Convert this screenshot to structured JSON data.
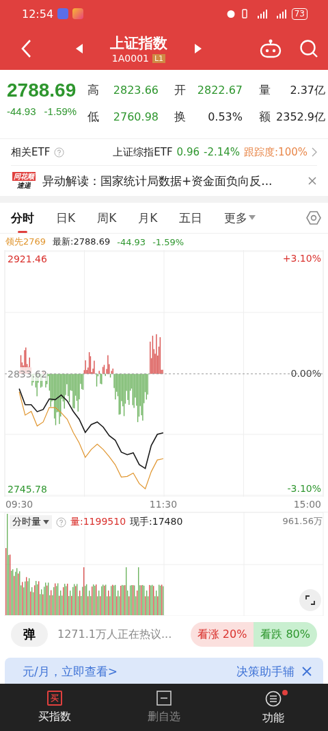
{
  "status_bar": {
    "time": "12:54",
    "battery": "73"
  },
  "header": {
    "title": "上证指数",
    "code": "1A0001",
    "level_badge": "L1"
  },
  "quote": {
    "price": "2788.69",
    "change": "-44.93",
    "change_pct": "-1.59%",
    "fields": [
      {
        "label": "高",
        "value": "2823.66",
        "color": "#2e962e"
      },
      {
        "label": "开",
        "value": "2822.67",
        "color": "#2e962e"
      },
      {
        "label": "量",
        "value": "2.37亿",
        "color": "#222222"
      },
      {
        "label": "低",
        "value": "2760.98",
        "color": "#2e962e"
      },
      {
        "label": "换",
        "value": "0.53%",
        "color": "#222222"
      },
      {
        "label": "额",
        "value": "2352.9亿",
        "color": "#222222"
      }
    ]
  },
  "etf": {
    "label": "相关ETF",
    "name": "上证综指ETF",
    "price": "0.96",
    "change_pct": "-2.14%",
    "tracking": "跟踪度:100%"
  },
  "news": {
    "logo_top": "同花顺",
    "logo_bottom": "速递",
    "text": "异动解读：国家统计局数据+资金面负向反..."
  },
  "tabs": [
    {
      "label": "分时",
      "selected": true,
      "dropdown": false
    },
    {
      "label": "日K",
      "selected": false,
      "dropdown": false
    },
    {
      "label": "周K",
      "selected": false,
      "dropdown": false
    },
    {
      "label": "月K",
      "selected": false,
      "dropdown": false
    },
    {
      "label": "五日",
      "selected": false,
      "dropdown": false
    },
    {
      "label": "更多",
      "selected": false,
      "dropdown": true
    }
  ],
  "chart_legend": {
    "lead": "领先2769",
    "latest": "最新:2788.69",
    "change": "-44.93",
    "change_pct": "-1.59%"
  },
  "price_chart": {
    "close_time_label": "15:00",
    "pct_labels": [
      "+3.10%",
      "0.00%",
      "-3.10%"
    ],
    "chart_data": {
      "type": "line",
      "x": [
        9.5,
        9.583,
        9.667,
        9.75,
        9.833,
        9.917,
        10,
        10.083,
        10.167,
        10.25,
        10.333,
        10.417,
        10.5,
        10.583,
        10.667,
        10.75,
        10.833,
        10.917,
        11,
        11.083,
        11.167,
        11.25,
        11.333,
        11.417,
        11.5
      ],
      "series": [
        {
          "color": "#1a1a1a",
          "values": [
            2822.3,
            2810.1,
            2810.1,
            2804.8,
            2806.5,
            2814.5,
            2814,
            2817.5,
            2813,
            2805,
            2799,
            2789,
            2795,
            2797,
            2793,
            2786.5,
            2783.1,
            2774,
            2772,
            2773.5,
            2764.5,
            2761.5,
            2779,
            2787.5,
            2788.7
          ]
        },
        {
          "color": "#e0952e",
          "values": [
            2819.9,
            2802.2,
            2805,
            2793.9,
            2797,
            2808,
            2808,
            2804,
            2799,
            2789,
            2781,
            2770,
            2776,
            2780,
            2776,
            2770.5,
            2764.4,
            2755,
            2755.5,
            2758,
            2750,
            2746,
            2759,
            2768,
            2769
          ]
        }
      ],
      "xlim": [
        9.3,
        13.72
      ],
      "ylim": [
        2740,
        2928
      ],
      "ref_lines": [
        {
          "axis": "y",
          "value": 2833.62
        }
      ],
      "xticks": [
        {
          "value": 9.5,
          "label": "09:30"
        },
        {
          "value": 11.5,
          "label": "11:30"
        }
      ],
      "yticks": [
        {
          "value": 2921.46,
          "label": "2921.46"
        },
        {
          "value": 2833.62,
          "label": "2833.62"
        },
        {
          "value": 2745.78,
          "label": "2745.78"
        }
      ]
    }
  },
  "volume": {
    "selector": "分时量",
    "volume": "量:1199510",
    "hand": "现手:17480",
    "max": "961.56万"
  },
  "sentiment": {
    "danmaku_button": "弹",
    "discussion": "1271.1万人正在热议...",
    "bull": "看涨 20%",
    "bear": "看跌 80%"
  },
  "banner": {
    "left": "元/月，立即查看>",
    "right": "决策助手辅"
  },
  "bottom_nav": [
    {
      "label": "买指数",
      "icon_text": "买",
      "kind": "buy",
      "disabled": false,
      "dot": false
    },
    {
      "label": "删自选",
      "kind": "box",
      "disabled": true,
      "dot": false
    },
    {
      "label": "功能",
      "kind": "menu",
      "disabled": false,
      "dot": true
    }
  ]
}
